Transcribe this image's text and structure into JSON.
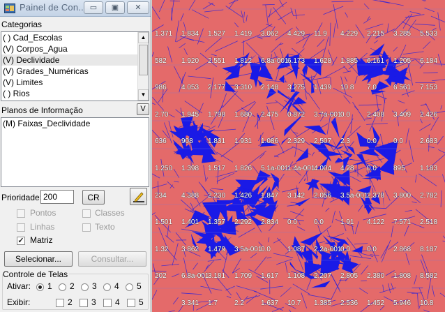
{
  "window": {
    "title": "Painel de Con...",
    "minimize_glyph": "▭",
    "maximize_glyph": "▣",
    "close_glyph": "✕"
  },
  "categories": {
    "label": "Categorias",
    "items": [
      {
        "label": "( ) Cad_Escolas",
        "selected": false
      },
      {
        "label": "(V) Corpos_Agua",
        "selected": false
      },
      {
        "label": "(V) Declividade",
        "selected": true
      },
      {
        "label": "(V) Grades_Numéricas",
        "selected": false
      },
      {
        "label": "(V) Limites",
        "selected": false
      },
      {
        "label": "( ) Rios",
        "selected": false
      }
    ]
  },
  "planes": {
    "label": "Planos de Informação",
    "toggle_label": "V",
    "items": [
      {
        "label": "(M) Faixas_Declividade"
      }
    ]
  },
  "priority": {
    "label": "Prioridade:",
    "value": "200",
    "cr_label": "CR"
  },
  "representations": {
    "pontos": {
      "label": "Pontos",
      "checked": false,
      "enabled": false
    },
    "classes": {
      "label": "Classes",
      "checked": false,
      "enabled": false
    },
    "linhas": {
      "label": "Linhas",
      "checked": false,
      "enabled": false
    },
    "texto": {
      "label": "Texto",
      "checked": false,
      "enabled": false
    },
    "matriz": {
      "label": "Matriz",
      "checked": true,
      "enabled": true,
      "mark": "✓"
    }
  },
  "buttons": {
    "select_label": "Selecionar...",
    "consult_label": "Consultar..."
  },
  "screens": {
    "label": "Controle de Telas",
    "activate_label": "Ativar:",
    "activate_options": [
      "1",
      "2",
      "3",
      "4",
      "5"
    ],
    "activate_selected": "1",
    "show_label": "Exibir:",
    "show_options": [
      "2",
      "3",
      "4",
      "5"
    ]
  },
  "map": {
    "colors": {
      "background": "#e46a6a",
      "mesh": "#1a1ae6",
      "grid": "#7b7bd8"
    },
    "value_rows": [
      [
        "1.371",
        "1.834",
        "1.527",
        "1.419",
        "3.062",
        "4.429",
        "11.9",
        "4.229",
        "2.215",
        "3.285",
        "5.533"
      ],
      [
        "582",
        "1.920",
        "2.551",
        "1.812",
        "6.8a-001",
        "6.173",
        "1.628",
        "1.885",
        "6.161",
        "1.205",
        "6.184"
      ],
      [
        "986",
        "4.053",
        "2.177",
        "3.310",
        "2.148",
        "3.275",
        "1.439",
        "10.8",
        "7.0",
        "6.561",
        "7.153"
      ],
      [
        "2.70",
        "1.945",
        "1.798",
        "1.680",
        "2.475",
        "0.872",
        "3.7a-001",
        "0.0",
        "2.408",
        "3.409",
        "2.426"
      ],
      [
        "636",
        "908",
        "1.831",
        "1.931",
        "1.086",
        "2.329",
        "2.507",
        "2.3",
        "0.0",
        "0.0",
        "2.683"
      ],
      [
        "1.250",
        "1.398",
        "1.517",
        "1.826",
        "5.1a-001",
        "1.4a-001",
        "4.004",
        "4.28",
        "0.0",
        "895",
        "1.183"
      ],
      [
        "234",
        "4.388",
        "2.230",
        "1.426",
        "1.847",
        "3.142",
        "2.056",
        "3.5a-001",
        "2.378",
        "3.800",
        "2.782"
      ],
      [
        "1.501",
        "1.401",
        "1.357",
        "2.292",
        "2.834",
        "0.0",
        "0.0",
        "1.91",
        "4.122",
        "7.571",
        "2.518"
      ],
      [
        "1.32",
        "3.862",
        "1.479",
        "3.5a-001",
        "0.0",
        "1.087",
        "2.2a-001",
        "0.0",
        "0.0",
        "2.868",
        "8.187"
      ],
      [
        "202",
        "6.8a-001",
        "3.181",
        "1.709",
        "1.617",
        "1.108",
        "2.207",
        "2.805",
        "2.380",
        "1.808",
        "8.582"
      ],
      [
        "",
        "3.341",
        "1.7",
        "2.2",
        "1.637",
        "10.7",
        "1.385",
        "2.536",
        "1.452",
        "5.946",
        "10.8"
      ]
    ]
  }
}
